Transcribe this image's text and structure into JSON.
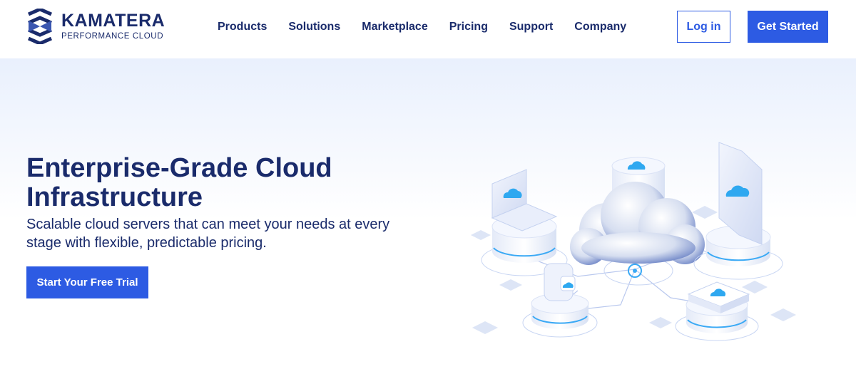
{
  "brand": {
    "name": "KAMATERA",
    "tagline": "PERFORMANCE CLOUD"
  },
  "nav": {
    "items": [
      "Products",
      "Solutions",
      "Marketplace",
      "Pricing",
      "Support",
      "Company"
    ]
  },
  "header_actions": {
    "login_label": "Log in",
    "get_started_label": "Get Started"
  },
  "hero": {
    "title": "Enterprise-Grade Cloud Infrastructure",
    "subtitle": "Scalable cloud servers that can meet your needs at every stage with flexible, predictable pricing.",
    "cta_label": "Start Your Free Trial"
  },
  "colors": {
    "navy": "#1a2b6b",
    "accent": "#2d5be3",
    "hero_bg_top": "#e9f0fd",
    "cloud_blue": "#2fa8f0"
  }
}
